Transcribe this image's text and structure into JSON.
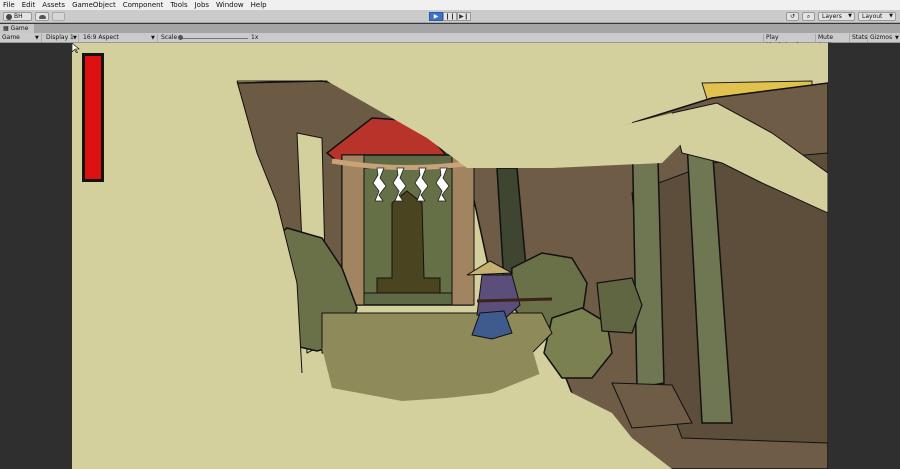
{
  "menu": [
    "File",
    "Edit",
    "Assets",
    "GameObject",
    "Component",
    "Tools",
    "Jobs",
    "Window",
    "Help"
  ],
  "toolbar": {
    "account_label": "BH",
    "play_icon": "▶",
    "pause_icon": "❙❙",
    "step_icon": "▶❙",
    "history_icon": "↺",
    "search_icon": "⌕",
    "layers_label": "Layers",
    "layout_label": "Layout"
  },
  "tab": {
    "label": "Game",
    "icon": "game-controller-icon"
  },
  "game_toolbar": {
    "mode": "Game",
    "display": "Display 1",
    "aspect": "16:9 Aspect",
    "scale_label": "Scale",
    "scale_value": "1x",
    "play_maximized": "Play Maximized",
    "mute_audio": "Mute Audio",
    "stats": "Stats",
    "gizmos": "Gizmos"
  },
  "game": {
    "health_fraction": 1.0,
    "colors": {
      "sky": "#d4d09e",
      "health": "#dd1111",
      "canopy_red": "#b8332a",
      "sun_yellow": "#e2c24e",
      "trunk_green": "#6f7652",
      "rock_brown": "#6e5c46",
      "bush_green": "#6a7048"
    }
  }
}
